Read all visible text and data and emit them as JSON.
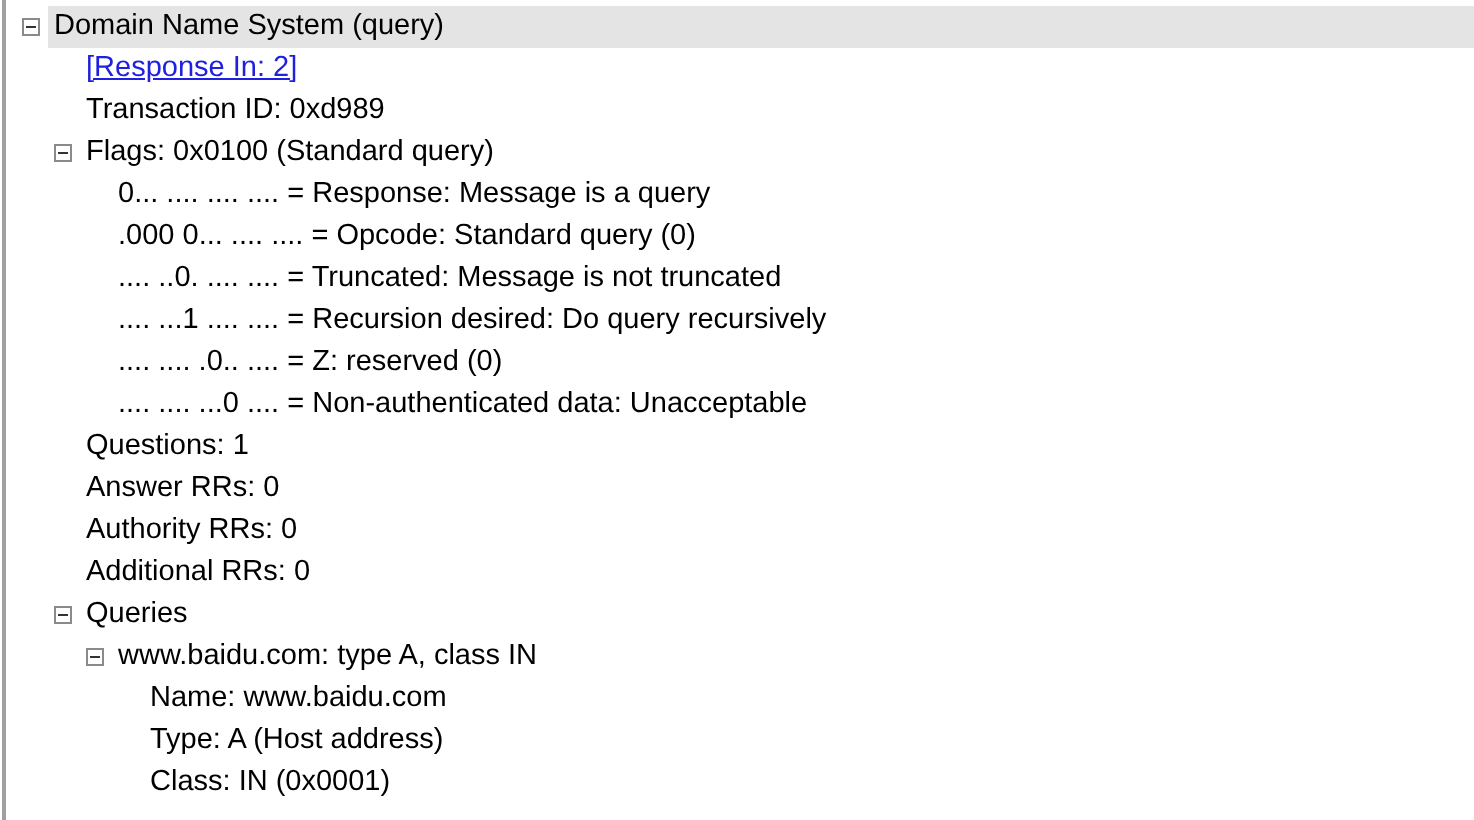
{
  "tree": [
    {
      "label": "Domain Name System (query)",
      "selected": true,
      "expanded": true,
      "children": [
        {
          "label": "[Response In: 2]",
          "kind": "link",
          "selected": false
        },
        {
          "label": "Transaction ID: 0xd989",
          "selected": false
        },
        {
          "label": "Flags: 0x0100 (Standard query)",
          "selected": false,
          "expanded": true,
          "children": [
            {
              "label": "0... .... .... .... = Response: Message is a query",
              "selected": false
            },
            {
              "label": ".000 0... .... .... = Opcode: Standard query (0)",
              "selected": false
            },
            {
              "label": ".... ..0. .... .... = Truncated: Message is not truncated",
              "selected": false
            },
            {
              "label": ".... ...1 .... .... = Recursion desired: Do query recursively",
              "selected": false
            },
            {
              "label": ".... .... .0.. .... = Z: reserved (0)",
              "selected": false
            },
            {
              "label": ".... .... ...0 .... = Non-authenticated data: Unacceptable",
              "selected": false
            }
          ]
        },
        {
          "label": "Questions: 1",
          "selected": false
        },
        {
          "label": "Answer RRs: 0",
          "selected": false
        },
        {
          "label": "Authority RRs: 0",
          "selected": false
        },
        {
          "label": "Additional RRs: 0",
          "selected": false
        },
        {
          "label": "Queries",
          "selected": false,
          "expanded": true,
          "children": [
            {
              "label": "www.baidu.com: type A, class IN",
              "selected": false,
              "expanded": true,
              "children": [
                {
                  "label": "Name: www.baidu.com",
                  "selected": false
                },
                {
                  "label": "Type: A (Host address)",
                  "selected": false
                },
                {
                  "label": "Class: IN (0x0001)",
                  "selected": false
                }
              ]
            }
          ]
        }
      ]
    }
  ]
}
